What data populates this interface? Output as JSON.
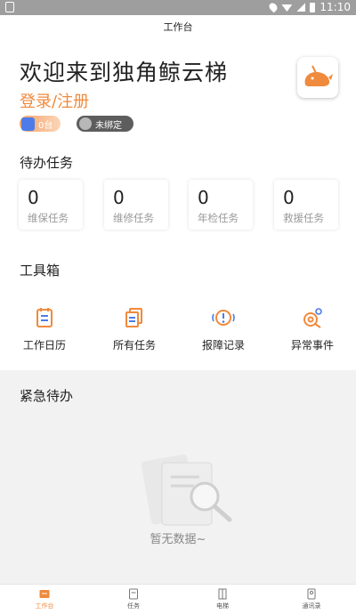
{
  "status_bar": {
    "time": "11:10"
  },
  "header": {
    "title": "工作台"
  },
  "welcome": {
    "title": "欢迎来到独角鲸云梯",
    "login_link": "登录/注册"
  },
  "badges": {
    "count_text": "0台",
    "wechat_text": "未绑定"
  },
  "pending": {
    "title": "待办任务",
    "items": [
      {
        "count": "0",
        "label": "维保任务"
      },
      {
        "count": "0",
        "label": "维修任务"
      },
      {
        "count": "0",
        "label": "年检任务"
      },
      {
        "count": "0",
        "label": "救援任务"
      }
    ]
  },
  "toolbox": {
    "title": "工具箱",
    "items": [
      {
        "label": "工作日历",
        "icon": "calendar-icon"
      },
      {
        "label": "所有任务",
        "icon": "task-list-icon"
      },
      {
        "label": "报障记录",
        "icon": "alert-icon"
      },
      {
        "label": "异常事件",
        "icon": "warning-gear-icon"
      }
    ]
  },
  "urgent": {
    "title": "紧急待办",
    "empty_text": "暂无数据~"
  },
  "tabs": [
    {
      "label": "工作台",
      "icon": "workbench-icon",
      "active": true
    },
    {
      "label": "任务",
      "icon": "task-icon",
      "active": false
    },
    {
      "label": "电梯",
      "icon": "elevator-icon",
      "active": false
    },
    {
      "label": "通讯录",
      "icon": "contacts-icon",
      "active": false
    }
  ],
  "colors": {
    "accent": "#f08a3c",
    "statusbar": "#9e9e9e",
    "section_bg": "#f2f2f2"
  }
}
